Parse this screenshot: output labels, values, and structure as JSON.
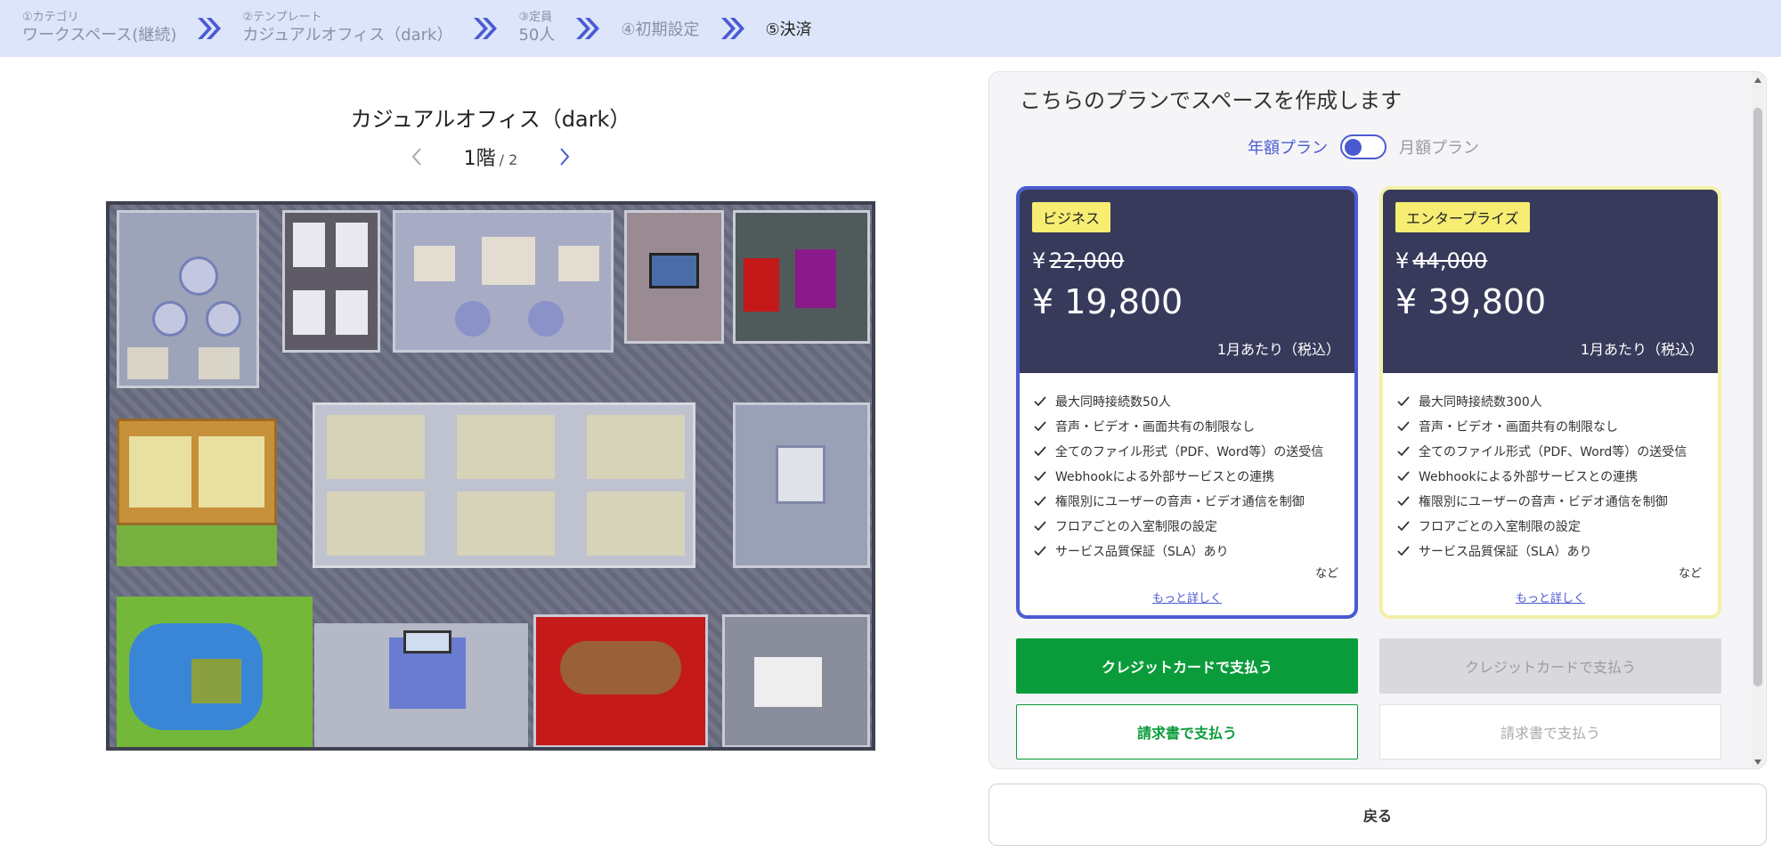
{
  "stepper": {
    "step1_label": "①カテゴリ",
    "step1_value": "ワークスペース(継続)",
    "step2_label": "②テンプレート",
    "step2_value": "カジュアルオフィス（dark）",
    "step3_label": "③定員",
    "step3_value": "50人",
    "step4_label": "④初期設定",
    "step5_label": "⑤決済",
    "chevron_color": "#4a5bd1"
  },
  "preview": {
    "title": "カジュアルオフィス（dark）",
    "floor": "1階",
    "floor_total": "/ 2"
  },
  "plan": {
    "heading": "こちらのプランでスペースを作成します",
    "toggle_annual": "年額プラン",
    "toggle_monthly": "月額プラン",
    "business": {
      "badge": "ビジネス",
      "currency": "¥",
      "old_price": "22,000",
      "price": "¥ 19,800",
      "per": "1月あたり（税込）",
      "features": [
        "最大同時接続数50人",
        "音声・ビデオ・画面共有の制限なし",
        "全てのファイル形式（PDF、Word等）の送受信",
        "Webhookによる外部サービスとの連携",
        "権限別にユーザーの音声・ビデオ通信を制御",
        "フロアごとの入室制限の設定",
        "サービス品質保証（SLA）あり"
      ],
      "etc": "など",
      "more": "もっと詳しく",
      "pay_card": "クレジットカードで支払う",
      "pay_invoice": "請求書で支払う"
    },
    "enterprise": {
      "badge": "エンタープライズ",
      "currency": "¥",
      "old_price": "44,000",
      "price": "¥ 39,800",
      "per": "1月あたり（税込）",
      "features": [
        "最大同時接続数300人",
        "音声・ビデオ・画面共有の制限なし",
        "全てのファイル形式（PDF、Word等）の送受信",
        "Webhookによる外部サービスとの連携",
        "権限別にユーザーの音声・ビデオ通信を制御",
        "フロアごとの入室制限の設定",
        "サービス品質保証（SLA）あり"
      ],
      "etc": "など",
      "more": "もっと詳しく",
      "pay_card": "クレジットカードで支払う",
      "pay_invoice": "請求書で支払う"
    }
  },
  "back_label": "戻る",
  "colors": {
    "accent": "#4a5bd1",
    "card_header": "#373a5a",
    "badge": "#f6ed72",
    "pay_green": "#0a9c3a"
  }
}
